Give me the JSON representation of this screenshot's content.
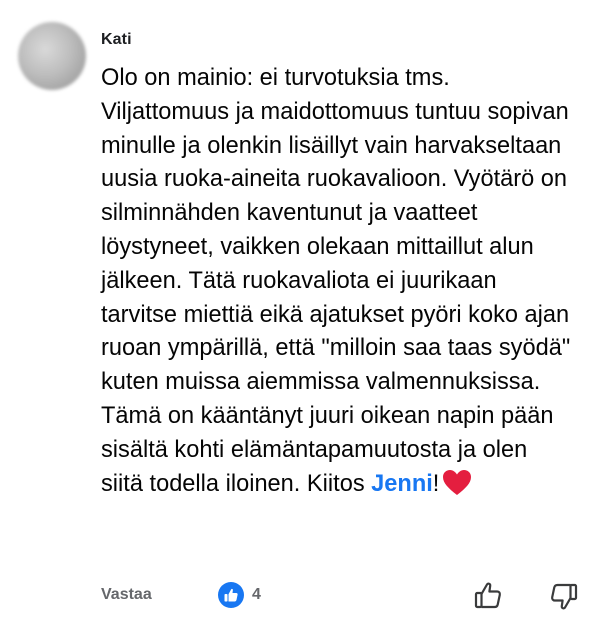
{
  "comment": {
    "author": "Kati",
    "text_before_mention": "Olo on mainio: ei turvotuksia tms. Viljattomuus ja maidottomuus tuntuu sopivan minulle ja olenkin lisäillyt vain harvakseltaan uusia ruoka-aineita ruokavalioon. Vyötärö on silminnähden kaventunut ja vaatteet löystyneet, vaikken olekaan mittaillut alun jälkeen. Tätä ruokavaliota ei juurikaan tarvitse miettiä eikä ajatukset pyöri koko ajan ruoan ympärillä, että \"milloin saa taas syödä\" kuten muissa aiemmissa valmennuksissa. Tämä on kääntänyt juuri oikean napin pään sisältä kohti elämäntapamuutosta ja olen siitä todella iloinen. Kiitos ",
    "mention": "Jenni",
    "text_after_mention": "!",
    "emoji": "heart-icon"
  },
  "actions": {
    "reply_label": "Vastaa",
    "like_count": "4",
    "like_icon": "thumbs-up-icon",
    "upvote_icon": "thumbs-up-outline-icon",
    "downvote_icon": "thumbs-down-outline-icon"
  },
  "colors": {
    "mention": "#1877f2",
    "like_badge": "#1877f2",
    "heart": "#e41e3f",
    "muted": "#65676b"
  }
}
